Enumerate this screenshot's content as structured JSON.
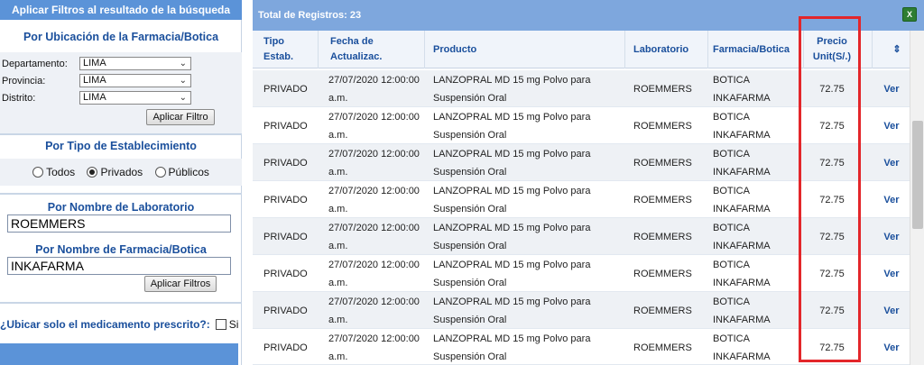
{
  "left": {
    "title": "Aplicar Filtros al resultado de la búsqueda",
    "ubicacion": {
      "title": "Por Ubicación de la Farmacia/Botica",
      "departamento_label": "Departamento:",
      "departamento_value": "LIMA",
      "provincia_label": "Provincia:",
      "provincia_value": "LIMA",
      "distrito_label": "Distrito:",
      "distrito_value": "LIMA",
      "apply_label": "Aplicar Filtro"
    },
    "establecimiento": {
      "title": "Por Tipo de Establecimiento",
      "opt_todos": "Todos",
      "opt_privados": "Privados",
      "opt_publicos": "Públicos",
      "selected": "Privados"
    },
    "laboratorio": {
      "title": "Por Nombre de Laboratorio",
      "value": "ROEMMERS"
    },
    "farmacia": {
      "title": "Por Nombre de Farmacia/Botica",
      "value": "INKAFARMA",
      "apply_label": "Aplicar Filtros"
    },
    "prescrito": {
      "question": "¿Ubicar solo el medicamento prescrito?:",
      "option": "Si"
    }
  },
  "right": {
    "total": "Total de Registros: 23",
    "export_icon": "excel-icon",
    "headers": {
      "tipo": "Tipo\nEstab.",
      "fecha": "Fecha de\nActualizac.",
      "producto": "Producto",
      "laboratorio": "Laboratorio",
      "farmacia": "Farmacia/Botica",
      "precio": "Precio\nUnit(S/.)"
    },
    "rows": [
      {
        "tipo": "PRIVADO",
        "fecha": "27/07/2020 12:00:00 a.m.",
        "producto": "LANZOPRAL MD 15 mg Polvo para Suspensión Oral",
        "laboratorio": "ROEMMERS",
        "farmacia": "BOTICA INKAFARMA",
        "precio": "72.75",
        "accion": "Ver"
      },
      {
        "tipo": "PRIVADO",
        "fecha": "27/07/2020 12:00:00 a.m.",
        "producto": "LANZOPRAL MD 15 mg Polvo para Suspensión Oral",
        "laboratorio": "ROEMMERS",
        "farmacia": "BOTICA INKAFARMA",
        "precio": "72.75",
        "accion": "Ver"
      },
      {
        "tipo": "PRIVADO",
        "fecha": "27/07/2020 12:00:00 a.m.",
        "producto": "LANZOPRAL MD 15 mg Polvo para Suspensión Oral",
        "laboratorio": "ROEMMERS",
        "farmacia": "BOTICA INKAFARMA",
        "precio": "72.75",
        "accion": "Ver"
      },
      {
        "tipo": "PRIVADO",
        "fecha": "27/07/2020 12:00:00 a.m.",
        "producto": "LANZOPRAL MD 15 mg Polvo para Suspensión Oral",
        "laboratorio": "ROEMMERS",
        "farmacia": "BOTICA INKAFARMA",
        "precio": "72.75",
        "accion": "Ver"
      },
      {
        "tipo": "PRIVADO",
        "fecha": "27/07/2020 12:00:00 a.m.",
        "producto": "LANZOPRAL MD 15 mg Polvo para Suspensión Oral",
        "laboratorio": "ROEMMERS",
        "farmacia": "BOTICA INKAFARMA",
        "precio": "72.75",
        "accion": "Ver"
      },
      {
        "tipo": "PRIVADO",
        "fecha": "27/07/2020 12:00:00 a.m.",
        "producto": "LANZOPRAL MD 15 mg Polvo para Suspensión Oral",
        "laboratorio": "ROEMMERS",
        "farmacia": "BOTICA INKAFARMA",
        "precio": "72.75",
        "accion": "Ver"
      },
      {
        "tipo": "PRIVADO",
        "fecha": "27/07/2020 12:00:00 a.m.",
        "producto": "LANZOPRAL MD 15 mg Polvo para Suspensión Oral",
        "laboratorio": "ROEMMERS",
        "farmacia": "BOTICA INKAFARMA",
        "precio": "72.75",
        "accion": "Ver"
      },
      {
        "tipo": "PRIVADO",
        "fecha": "27/07/2020 12:00:00 a.m.",
        "producto": "LANZOPRAL MD 15 mg Polvo para Suspensión Oral",
        "laboratorio": "ROEMMERS",
        "farmacia": "BOTICA INKAFARMA",
        "precio": "72.75",
        "accion": "Ver"
      }
    ]
  },
  "colors": {
    "header_blue": "#5b93d8",
    "title_blue": "#1a4f9c",
    "highlight_red": "#e3262a"
  }
}
